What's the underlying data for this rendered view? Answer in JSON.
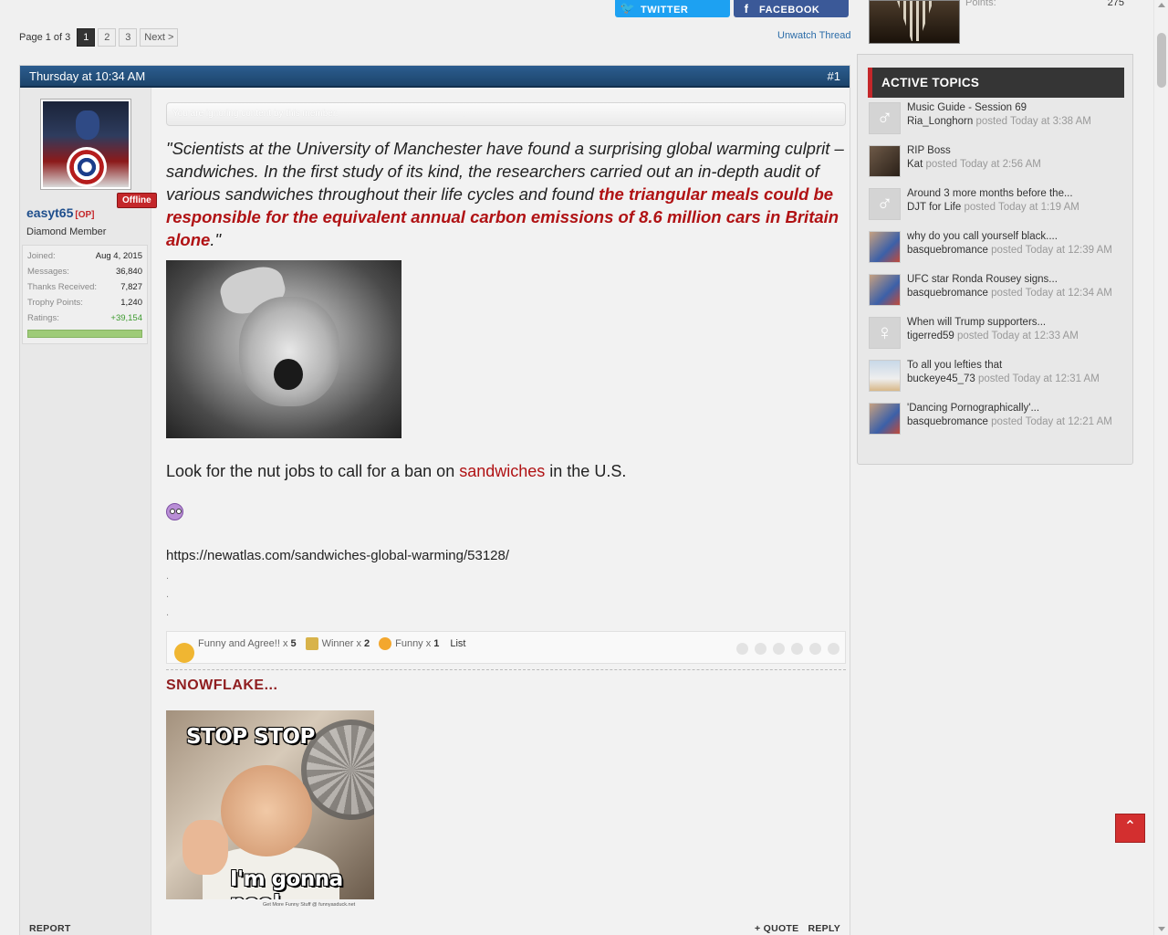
{
  "pagination": {
    "label": "Page 1 of 3",
    "pages": [
      "1",
      "2",
      "3"
    ],
    "next": "Next >"
  },
  "share": {
    "twitter": "TWITTER",
    "facebook": "FACEBOOK"
  },
  "unwatch": "Unwatch Thread",
  "post": {
    "date": "Thursday at 10:34 AM",
    "number": "#1",
    "user": {
      "name": "easyt65",
      "op": "[OP]",
      "title": "Diamond Member",
      "status": "Offline",
      "stats": [
        {
          "k": "Joined:",
          "v": "Aug 4, 2015"
        },
        {
          "k": "Messages:",
          "v": "36,840"
        },
        {
          "k": "Thanks Received:",
          "v": "7,827"
        },
        {
          "k": "Trophy Points:",
          "v": "1,240"
        },
        {
          "k": "Ratings:",
          "v": "+39,154"
        }
      ]
    },
    "ignored": "You are ignoring content by this member.",
    "quote_plain": "\"Scientists at the University of Manchester have found a surprising global warming culprit – sandwiches. In the first study of its kind, the researchers carried out an in-depth audit of various sandwiches throughout their life cycles and found ",
    "quote_red": "the triangular meals could be responsible for the equivalent annual carbon emissions of 8.6 million cars in Britain alone",
    "quote_end": ".\"",
    "body_before": "Look for the nut jobs to call for a ban on ",
    "body_link": "sandwiches",
    "body_after": " in the U.S.",
    "url": "https://newatlas.com/sandwiches-global-warming/53128/",
    "dots": [
      ".",
      ".",
      "."
    ],
    "reactions": [
      {
        "label": "Funny and Agree!! x",
        "count": "5",
        "color": "#f0b632"
      },
      {
        "label": "Winner x",
        "count": "2",
        "color": "#d8b34a"
      },
      {
        "label": "Funny x",
        "count": "1",
        "color": "#f3a72e"
      }
    ],
    "reactions_list": "List",
    "snowflake": "SNOWFLAKE...",
    "meme_top": "STOP STOP",
    "meme_bottom": "I'm gonna pee!",
    "meme_credit": "Get More Funny Stuff @ funnyasduck.net",
    "footer": {
      "report": "REPORT",
      "quote": "+ QUOTE",
      "reply": "REPLY"
    }
  },
  "sidebar": {
    "points_label": "Points:",
    "points_value": "275",
    "heading": "ACTIVE TOPICS",
    "topics": [
      {
        "title": "Music Guide - Session 69",
        "user": "Ria_Longhorn",
        "time": "posted Today at 3:38 AM",
        "avatar": "male"
      },
      {
        "title": "RIP Boss",
        "user": "Kat",
        "time": "posted Today at 2:56 AM",
        "avatar": "photo-a"
      },
      {
        "title": "Around 3 more months before the...",
        "user": "DJT for Life",
        "time": "posted Today at 1:19 AM",
        "avatar": "male"
      },
      {
        "title": "why do you call yourself black....",
        "user": "basquebromance",
        "time": "posted Today at 12:39 AM",
        "avatar": "photo-b"
      },
      {
        "title": "UFC star Ronda Rousey signs...",
        "user": "basquebromance",
        "time": "posted Today at 12:34 AM",
        "avatar": "photo-b"
      },
      {
        "title": "When will Trump supporters...",
        "user": "tigerred59",
        "time": "posted Today at 12:33 AM",
        "avatar": "female"
      },
      {
        "title": "To all you lefties that",
        "user": "buckeye45_73",
        "time": "posted Today at 12:31 AM",
        "avatar": "photo-c"
      },
      {
        "title": "'Dancing Pornographically'...",
        "user": "basquebromance",
        "time": "posted Today at 12:21 AM",
        "avatar": "photo-b"
      }
    ]
  },
  "icons": {
    "twitter": "twitter-bird-icon",
    "facebook": "facebook-f-icon",
    "to_top": "chevron-up-icon",
    "male": "male-symbol-icon",
    "female": "female-symbol-icon"
  }
}
